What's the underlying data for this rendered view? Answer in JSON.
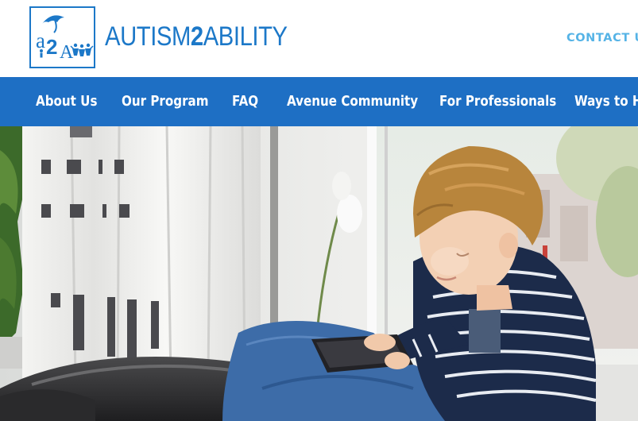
{
  "header": {
    "logo_text": {
      "part1": "AUTISM",
      "part2": "2",
      "part3": "ABILITY"
    },
    "contact_label": "CONTACT U"
  },
  "nav": {
    "items": [
      {
        "label": "About Us"
      },
      {
        "label": "Our Program"
      },
      {
        "label": "FAQ"
      },
      {
        "label": "Avenue Community"
      },
      {
        "label": "For Professionals"
      },
      {
        "label": "Ways to H"
      }
    ]
  },
  "colors": {
    "brand_blue": "#1c78c8",
    "nav_blue": "#1e6fc4",
    "contact_blue": "#55b3e6"
  },
  "hero": {
    "image_subject": "boy-with-tablet-photo"
  }
}
